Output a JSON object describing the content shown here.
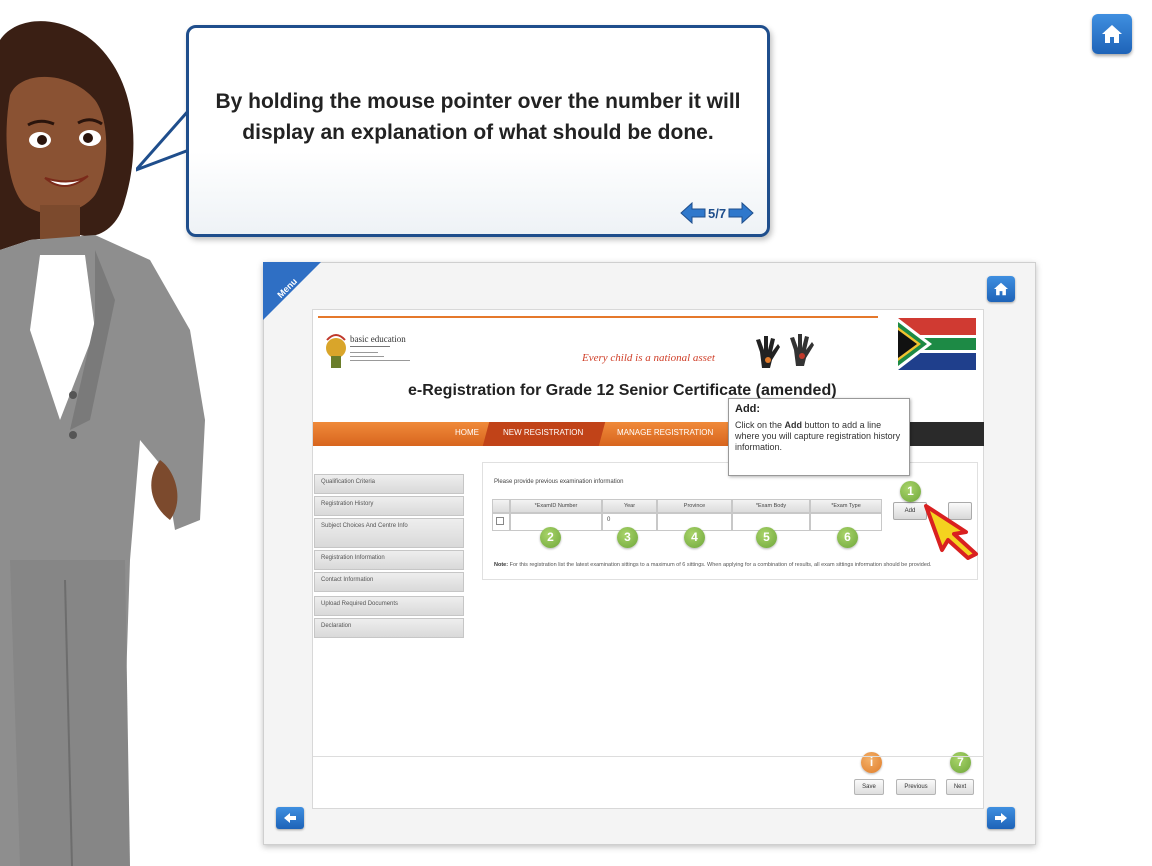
{
  "bubble": {
    "text": "By holding the mouse pointer over the number it will display an explanation of what should be done.",
    "page_indicator": "5/7"
  },
  "menu_tab": {
    "label": "Menu"
  },
  "site": {
    "logo_text": "basic education",
    "motto": "Every child is a national asset",
    "page_title": "e-Registration for Grade 12 Senior Certificate (amended)",
    "nav": [
      "HOME",
      "NEW REGISTRATION",
      "MANAGE REGISTRATION"
    ]
  },
  "sidebar": {
    "items": [
      {
        "label": "Qualification Criteria"
      },
      {
        "label": "Registration History"
      },
      {
        "label": "Subject Choices And Centre Info"
      },
      {
        "label": "Registration Information"
      },
      {
        "label": "Contact Information"
      },
      {
        "label": "Upload Required Documents"
      },
      {
        "label": "Declaration"
      }
    ]
  },
  "form": {
    "prompt": "Please provide previous examination information",
    "columns": [
      "*ExamID Number",
      "Year",
      "Province",
      "*Exam Body",
      "*Exam Type"
    ],
    "row": {
      "year": "0"
    },
    "add_button": "Add",
    "note_label": "Note:",
    "note_text": "For this registration list the latest examination sittings to a maximum of 6 sittings. When applying for a combination of results, all exam sittings information should be provided."
  },
  "markers": [
    "1",
    "2",
    "3",
    "4",
    "5",
    "6",
    "7"
  ],
  "tooltip": {
    "title": "Add:",
    "body_before": "Click on the ",
    "body_bold": "Add",
    "body_after": " button to add a line where you will capture registration history information."
  },
  "footer": {
    "info_marker": "i",
    "buttons": [
      "Save",
      "Previous",
      "Next"
    ]
  },
  "colors": {
    "brand_blue": "#1f4e8c",
    "nav_orange": "#e5782b",
    "marker_green": "#7bb241",
    "marker_orange": "#e88a35"
  },
  "icons": [
    "home-icon",
    "arrow-left-icon",
    "arrow-right-icon",
    "hand-pointer-arrow-icon"
  ]
}
